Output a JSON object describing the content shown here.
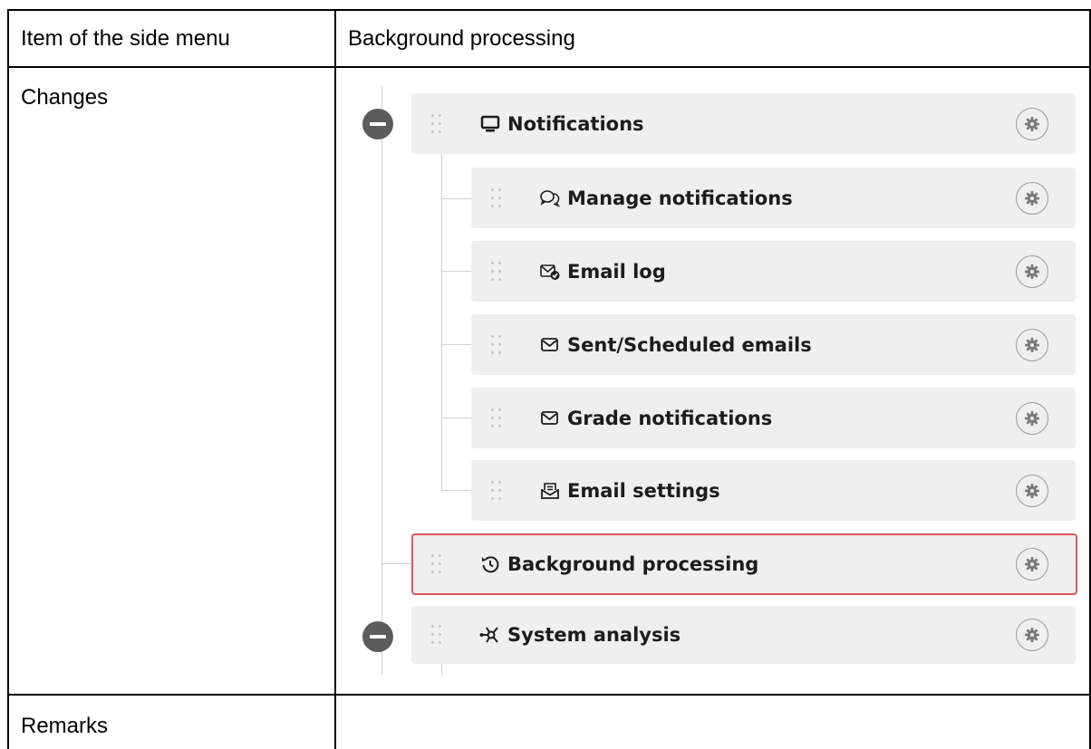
{
  "table": {
    "rows": [
      {
        "label": "Item of the side menu",
        "value": "Background processing"
      },
      {
        "label": "Changes"
      },
      {
        "label": "Remarks",
        "value": ""
      }
    ]
  },
  "menu_tree": {
    "items": [
      {
        "label": "Notifications",
        "icon": "monitor-icon",
        "level": 0,
        "expandable": true
      },
      {
        "label": "Manage notifications",
        "icon": "chat-bubbles-icon",
        "level": 1
      },
      {
        "label": "Email log",
        "icon": "mail-check-icon",
        "level": 1
      },
      {
        "label": "Sent/Scheduled emails",
        "icon": "envelope-icon",
        "level": 1
      },
      {
        "label": "Grade notifications",
        "icon": "envelope-icon",
        "level": 1
      },
      {
        "label": "Email settings",
        "icon": "mail-settings-icon",
        "level": 1
      },
      {
        "label": "Background processing",
        "icon": "history-icon",
        "level": 0,
        "highlighted": true
      },
      {
        "label": "System analysis",
        "icon": "network-icon",
        "level": 0,
        "expandable": true
      }
    ],
    "highlight_color": "#e0525a"
  }
}
